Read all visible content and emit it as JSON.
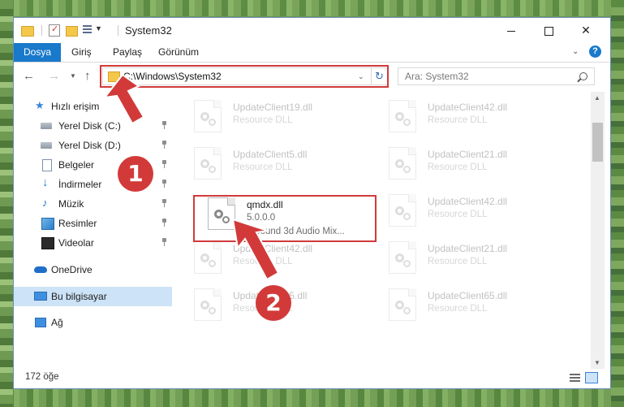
{
  "window": {
    "title": "System32"
  },
  "ribbon": {
    "tabs": [
      "Dosya",
      "Giriş",
      "Paylaş",
      "Görünüm"
    ],
    "help": "?"
  },
  "navigation": {
    "address": "C:\\Windows\\System32",
    "search_placeholder": "Ara: System32"
  },
  "sidebar": {
    "items": [
      {
        "label": "Hızlı erişim",
        "icon": "star-icon"
      },
      {
        "label": "Yerel Disk (C:)",
        "icon": "disk-icon",
        "pinned": true
      },
      {
        "label": "Yerel Disk (D:)",
        "icon": "disk-icon",
        "pinned": true
      },
      {
        "label": "Belgeler",
        "icon": "document-icon",
        "pinned": true
      },
      {
        "label": "İndirmeler",
        "icon": "download-icon",
        "pinned": true
      },
      {
        "label": "Müzik",
        "icon": "music-icon",
        "pinned": true
      },
      {
        "label": "Resimler",
        "icon": "pictures-icon",
        "pinned": true
      },
      {
        "label": "Videolar",
        "icon": "videos-icon",
        "pinned": true
      },
      {
        "label": "OneDrive",
        "icon": "cloud-icon"
      },
      {
        "label": "Bu bilgisayar",
        "icon": "computer-icon",
        "selected": true
      },
      {
        "label": "Ağ",
        "icon": "network-icon"
      }
    ]
  },
  "files": [
    {
      "name": "UpdateClient19.dll",
      "sub": "Resource DLL"
    },
    {
      "name": "UpdateClient42.dll",
      "sub": "Resource DLL"
    },
    {
      "name": "UpdateClient5.dll",
      "sub": "Resource DLL"
    },
    {
      "name": "UpdateClient21.dll",
      "sub": "Resource DLL"
    },
    {
      "name": "qmdx.dll",
      "sub": "5.0.0.0",
      "sub2": "QSound 3d Audio Mix...",
      "highlighted": true
    },
    {
      "name": "UpdateClient42.dll",
      "sub": "Resource DLL"
    },
    {
      "name": "UpdateClient42.dll",
      "sub": "Resource DLL"
    },
    {
      "name": "UpdateClient21.dll",
      "sub": "Resource DLL"
    },
    {
      "name": "UpdateClient5.dll",
      "sub": "Resource DLL"
    },
    {
      "name": "UpdateClient65.dll",
      "sub": "Resource DLL"
    }
  ],
  "status": {
    "item_count": "172 öğe"
  },
  "annotations": {
    "callout1": "1",
    "callout2": "2",
    "color": "#d23a3a"
  },
  "colors": {
    "accent": "#1979ca",
    "selection": "#cde3f7"
  }
}
